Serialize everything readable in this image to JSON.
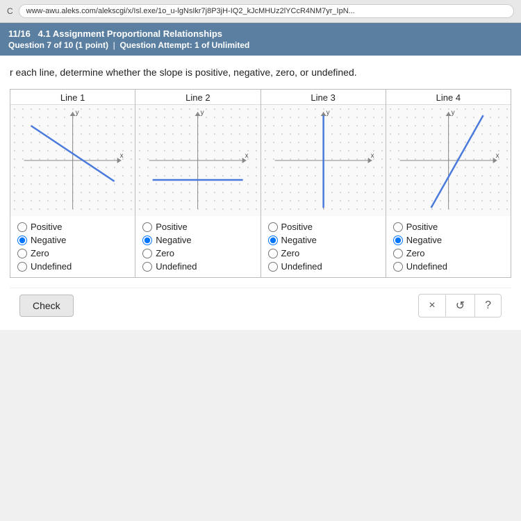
{
  "browser": {
    "url": "www-awu.aleks.com/alekscgi/x/Isl.exe/1o_u-lgNsIkr7j8P3jH-IQ2_kJcMHUz2lYCcR4NM7yr_IpN...",
    "refresh_label": "C"
  },
  "header": {
    "progress": "11/16",
    "assignment": "4.1 Assignment Proportional Relationships",
    "question_label": "Question 7 of 10 (1 point)",
    "attempt_label": "Question Attempt: 1 of Unlimited"
  },
  "instruction": "r each line, determine whether the slope is positive, negative, zero, or undefined.",
  "lines": [
    {
      "id": "line1",
      "title": "Line 1",
      "slope_type": "negative_diagonal",
      "selected": "Negative"
    },
    {
      "id": "line2",
      "title": "Line 2",
      "slope_type": "horizontal",
      "selected": "Negative"
    },
    {
      "id": "line3",
      "title": "Line 3",
      "slope_type": "vertical",
      "selected": "Negative"
    },
    {
      "id": "line4",
      "title": "Line 4",
      "slope_type": "positive_diagonal",
      "selected": "Negative"
    }
  ],
  "options": [
    "Positive",
    "Negative",
    "Zero",
    "Undefined"
  ],
  "buttons": {
    "check": "Check",
    "times": "×",
    "undo": "↺",
    "question": "?"
  }
}
